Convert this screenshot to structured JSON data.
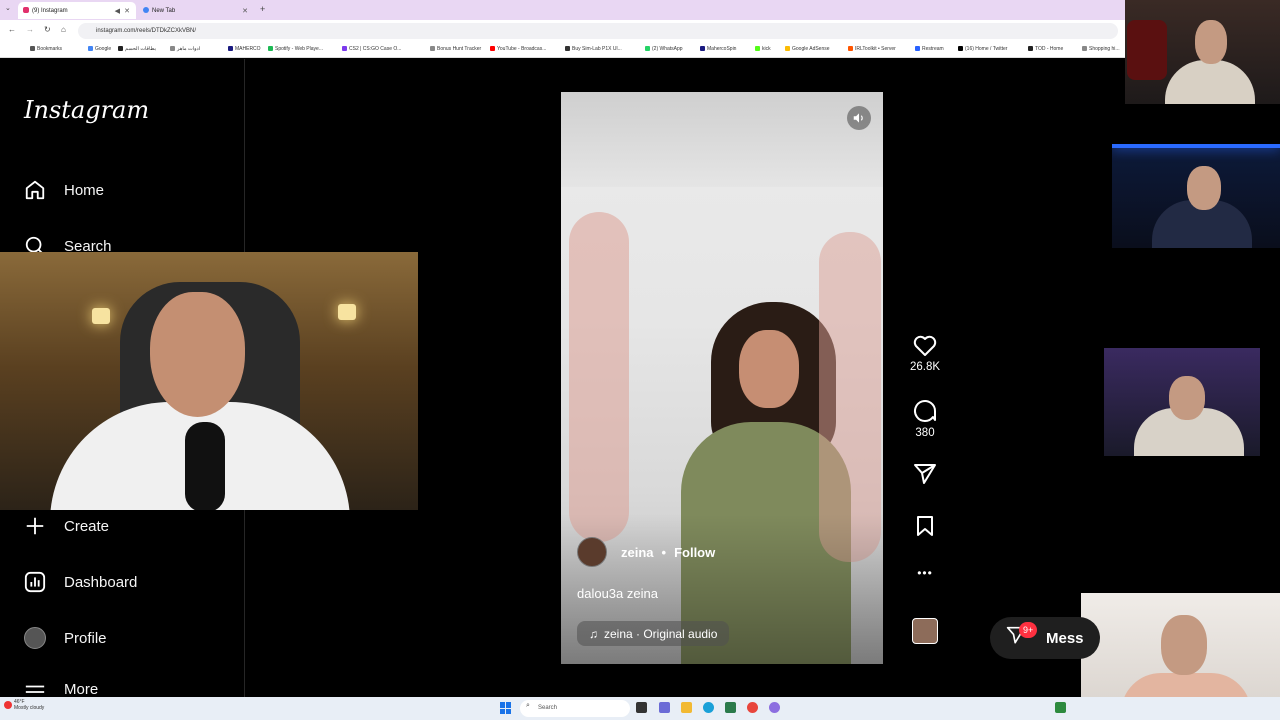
{
  "browser": {
    "tabs": [
      {
        "label": "(9) Instagram",
        "active": true
      },
      {
        "label": "New Tab",
        "active": false
      }
    ],
    "url": "instagram.com/reels/DTDkZCXkVBN/",
    "bookmarks": [
      "Bookmarks",
      "Google",
      "بطاقات الحسم",
      "ادوات ماهر",
      "MAHERCO",
      "Spotify - Web Playe...",
      "CS2 | CS:GO Case O...",
      "Bonus Hunt Tracker",
      "YouTube - Broadcas...",
      "Buy Sim-Lab P1X Ul...",
      "(2) WhatsApp",
      "MahercoSpin",
      "kick",
      "Google AdSense",
      "IRLToolkit • Server",
      "Restream",
      "(16) Home / Twitter",
      "TOD - Home",
      "Shopping hi..."
    ]
  },
  "sidebar": {
    "logo": "Instagram",
    "items": [
      {
        "label": "Home",
        "icon": "home-icon"
      },
      {
        "label": "Search",
        "icon": "search-icon"
      },
      {
        "label": "Create",
        "icon": "plus-icon"
      },
      {
        "label": "Dashboard",
        "icon": "dashboard-icon"
      },
      {
        "label": "Profile",
        "icon": "avatar"
      },
      {
        "label": "More",
        "icon": "menu-icon"
      }
    ]
  },
  "reel": {
    "username": "zeina",
    "dot": "•",
    "follow_label": "Follow",
    "caption": "dalou3a zeina",
    "audio": "zeina · Original audio",
    "likes": "26.8K",
    "comments": "380",
    "more": "•••"
  },
  "messages": {
    "label": "Mess",
    "badge": "9+"
  },
  "taskbar": {
    "search_placeholder": "Search",
    "weather_temp": "46°F",
    "weather_desc": "Mostly cloudy"
  }
}
